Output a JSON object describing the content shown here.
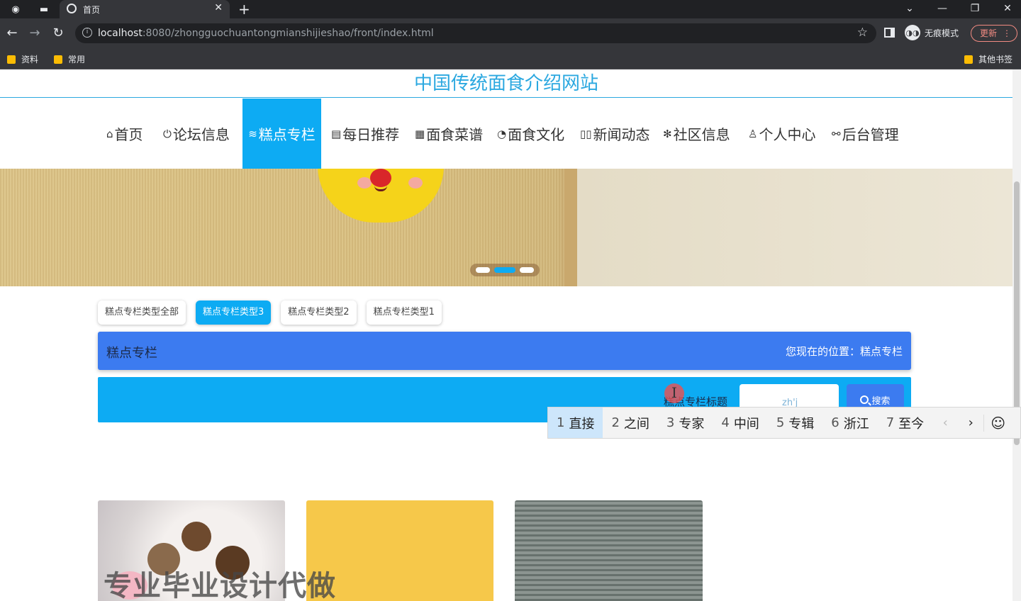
{
  "browser": {
    "tab_title": "首页",
    "url_host": "localhost",
    "url_rest": ":8080/zhongguochuantongmianshijieshao/front/index.html",
    "incognito_label": "无痕模式",
    "update_label": "更新",
    "bookmarks": [
      "资料",
      "常用"
    ],
    "other_bookmarks": "其他书签"
  },
  "site": {
    "title": "中国传统面食介绍网站",
    "nav": [
      {
        "icon": "⌂",
        "label": "首页"
      },
      {
        "icon": "⏻",
        "label": "论坛信息"
      },
      {
        "icon": "≋",
        "label": "糕点专栏"
      },
      {
        "icon": "▤",
        "label": "每日推荐"
      },
      {
        "icon": "▦",
        "label": "面食菜谱"
      },
      {
        "icon": "◔",
        "label": "面食文化"
      },
      {
        "icon": "▯▯",
        "label": "新闻动态"
      },
      {
        "icon": "✻",
        "label": "社区信息"
      },
      {
        "icon": "♙",
        "label": "个人中心"
      },
      {
        "icon": "⚯",
        "label": "后台管理"
      }
    ],
    "active_nav": "糕点专栏"
  },
  "banner": {
    "slides": 3,
    "active_slide": 2
  },
  "type_tabs": [
    "糕点专栏类型全部",
    "糕点专栏类型3",
    "糕点专栏类型2",
    "糕点专栏类型1"
  ],
  "active_type": "糕点专栏类型3",
  "crumb": {
    "section": "糕点专栏",
    "location": "您现在的位置：糕点专栏"
  },
  "search": {
    "label": "糕点专栏标题",
    "value": "zh'j",
    "button": "搜索"
  },
  "ime": {
    "candidates": [
      {
        "n": "1",
        "w": "直接"
      },
      {
        "n": "2",
        "w": "之间"
      },
      {
        "n": "3",
        "w": "专家"
      },
      {
        "n": "4",
        "w": "中间"
      },
      {
        "n": "5",
        "w": "专辑"
      },
      {
        "n": "6",
        "w": "浙江"
      },
      {
        "n": "7",
        "w": "至今"
      }
    ]
  },
  "watermark": "专业毕业设计代做",
  "colors": {
    "accent": "#0dabf3",
    "crumb_bar": "#3c7bf0",
    "title": "#2ba8e0"
  }
}
